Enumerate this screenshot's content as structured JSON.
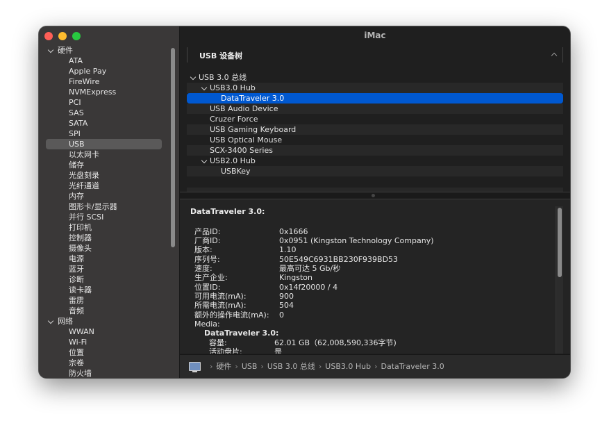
{
  "window": {
    "title": "iMac"
  },
  "sidebar": {
    "groups": [
      {
        "label": "硬件",
        "items": [
          "ATA",
          "Apple Pay",
          "FireWire",
          "NVMExpress",
          "PCI",
          "SAS",
          "SATA",
          "SPI",
          "USB",
          "以太网卡",
          "储存",
          "光盘刻录",
          "光纤通道",
          "内存",
          "图形卡/显示器",
          "并行 SCSI",
          "打印机",
          "控制器",
          "摄像头",
          "电源",
          "蓝牙",
          "诊断",
          "读卡器",
          "雷雳",
          "音频"
        ]
      },
      {
        "label": "网络",
        "items": [
          "WWAN",
          "Wi-Fi",
          "位置",
          "宗卷",
          "防火墙"
        ]
      }
    ],
    "selected": "USB"
  },
  "section": {
    "title": "USB 设备树"
  },
  "usb_tree": [
    {
      "label": "USB 3.0 总线",
      "level": 0,
      "expanded": true
    },
    {
      "label": "USB3.0 Hub",
      "level": 1,
      "expanded": true
    },
    {
      "label": "DataTraveler 3.0",
      "level": 2,
      "selected": true
    },
    {
      "label": "USB Audio Device",
      "level": 1
    },
    {
      "label": "Cruzer Force",
      "level": 1
    },
    {
      "label": "USB Gaming Keyboard",
      "level": 1
    },
    {
      "label": "USB Optical Mouse",
      "level": 1
    },
    {
      "label": "SCX-3400 Series",
      "level": 1
    },
    {
      "label": "USB2.0 Hub",
      "level": 1,
      "expanded": true
    },
    {
      "label": "USBKey",
      "level": 2
    }
  ],
  "details": {
    "heading": "DataTraveler 3.0:",
    "fields": [
      {
        "key": "产品ID:",
        "value": "0x1666"
      },
      {
        "key": "厂商ID:",
        "value": "0x0951  (Kingston Technology Company)"
      },
      {
        "key": "版本:",
        "value": "1.10"
      },
      {
        "key": "序列号:",
        "value": "50E549C6931BB230F939BD53"
      },
      {
        "key": "速度:",
        "value": "最高可达 5 Gb/秒"
      },
      {
        "key": "生产企业:",
        "value": "Kingston"
      },
      {
        "key": "位置ID:",
        "value": "0x14f20000 / 4"
      },
      {
        "key": "可用电流(mA):",
        "value": "900"
      },
      {
        "key": "所需电流(mA):",
        "value": "504"
      },
      {
        "key": "额外的操作电流(mA):",
        "value": "0"
      },
      {
        "key": "Media:",
        "value": ""
      }
    ],
    "media": {
      "heading": "DataTraveler 3.0:",
      "fields": [
        {
          "key": "容量:",
          "value": "62.01 GB（62,008,590,336字节)"
        },
        {
          "key": "活动盘片:",
          "value": "是"
        }
      ]
    }
  },
  "pathbar": {
    "crumbs": [
      "硬件",
      "USB",
      "USB 3.0 总线",
      "USB3.0 Hub",
      "DataTraveler 3.0"
    ]
  }
}
